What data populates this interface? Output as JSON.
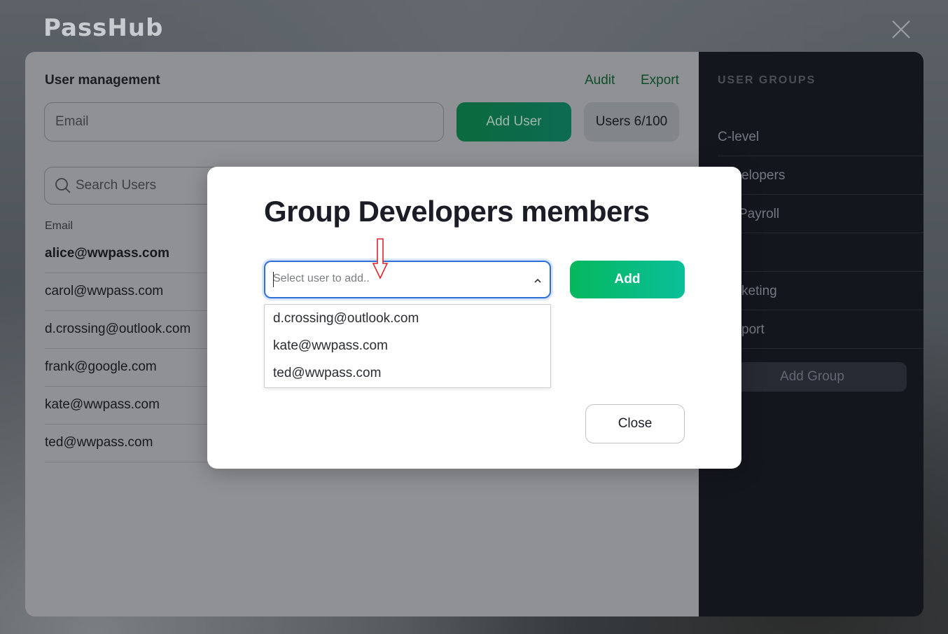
{
  "app": {
    "logo": "PassHub"
  },
  "user_management": {
    "title": "User management",
    "links": {
      "audit": "Audit",
      "export": "Export"
    },
    "email_placeholder": "Email",
    "add_user_label": "Add User",
    "users_count": "Users 6/100",
    "search_placeholder": "Search Users",
    "column_email": "Email",
    "users": [
      "alice@wwpass.com",
      "carol@wwpass.com",
      "d.crossing@outlook.com",
      "frank@google.com",
      "kate@wwpass.com",
      "ted@wwpass.com"
    ]
  },
  "user_groups": {
    "title": "USER GROUPS",
    "groups": [
      "C-level",
      "elopers",
      "Payroll",
      "",
      "keting",
      "port"
    ],
    "add_group_label": "Add Group"
  },
  "modal": {
    "title": "Group Developers members",
    "select_placeholder": "Select user to add..",
    "add_label": "Add",
    "options": [
      "d.crossing@outlook.com",
      "kate@wwpass.com",
      "ted@wwpass.com"
    ],
    "close_label": "Close"
  },
  "colors": {
    "accent_green": "#05b85e",
    "focus_blue": "#2f6fd8",
    "annotation_red": "#d9262c"
  }
}
